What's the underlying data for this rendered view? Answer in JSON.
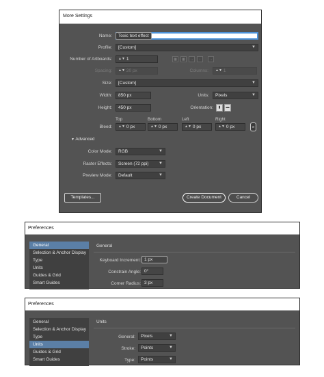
{
  "more_settings": {
    "title": "More Settings",
    "name": {
      "label": "Name:",
      "value": "Toxic text effect"
    },
    "profile": {
      "label": "Profile:",
      "value": "[Custom]"
    },
    "artboards": {
      "label": "Number of Artboards:",
      "value": "1"
    },
    "spacing": {
      "label": "Spacing:",
      "value": "20 px"
    },
    "columns": {
      "label": "Columns:",
      "value": "1"
    },
    "size": {
      "label": "Size:",
      "value": "[Custom]"
    },
    "width": {
      "label": "Width:",
      "value": "850 px"
    },
    "height": {
      "label": "Height:",
      "value": "450 px"
    },
    "units": {
      "label": "Units:",
      "value": "Pixels"
    },
    "orientation": {
      "label": "Orientation:"
    },
    "bleed": {
      "label": "Bleed:",
      "top": {
        "label": "Top",
        "value": "0 px"
      },
      "bottom": {
        "label": "Bottom",
        "value": "0 px"
      },
      "left": {
        "label": "Left",
        "value": "0 px"
      },
      "right": {
        "label": "Right",
        "value": "0 px"
      }
    },
    "advanced": {
      "label": "Advanced"
    },
    "color_mode": {
      "label": "Color Mode:",
      "value": "RGB"
    },
    "raster_effects": {
      "label": "Raster Effects:",
      "value": "Screen (72 ppi)"
    },
    "preview_mode": {
      "label": "Preview Mode:",
      "value": "Default"
    },
    "buttons": {
      "templates": "Templates...",
      "create": "Create Document",
      "cancel": "Cancel"
    }
  },
  "prefs_general": {
    "title": "Preferences",
    "list": [
      "General",
      "Selection & Anchor Display",
      "Type",
      "Units",
      "Guides & Grid",
      "Smart Guides"
    ],
    "selected": "General",
    "section": "General",
    "keyboard_increment": {
      "label": "Keyboard Increment:",
      "value": "1 px"
    },
    "constrain_angle": {
      "label": "Constrain Angle:",
      "value": "0°"
    },
    "corner_radius": {
      "label": "Corner Radius:",
      "value": "3 px"
    }
  },
  "prefs_units": {
    "title": "Preferences",
    "list": [
      "General",
      "Selection & Anchor Display",
      "Type",
      "Units",
      "Guides & Grid",
      "Smart Guides"
    ],
    "selected": "Units",
    "section": "Units",
    "general": {
      "label": "General:",
      "value": "Pixels"
    },
    "stroke": {
      "label": "Stroke:",
      "value": "Points"
    },
    "type": {
      "label": "Type:",
      "value": "Points"
    }
  }
}
